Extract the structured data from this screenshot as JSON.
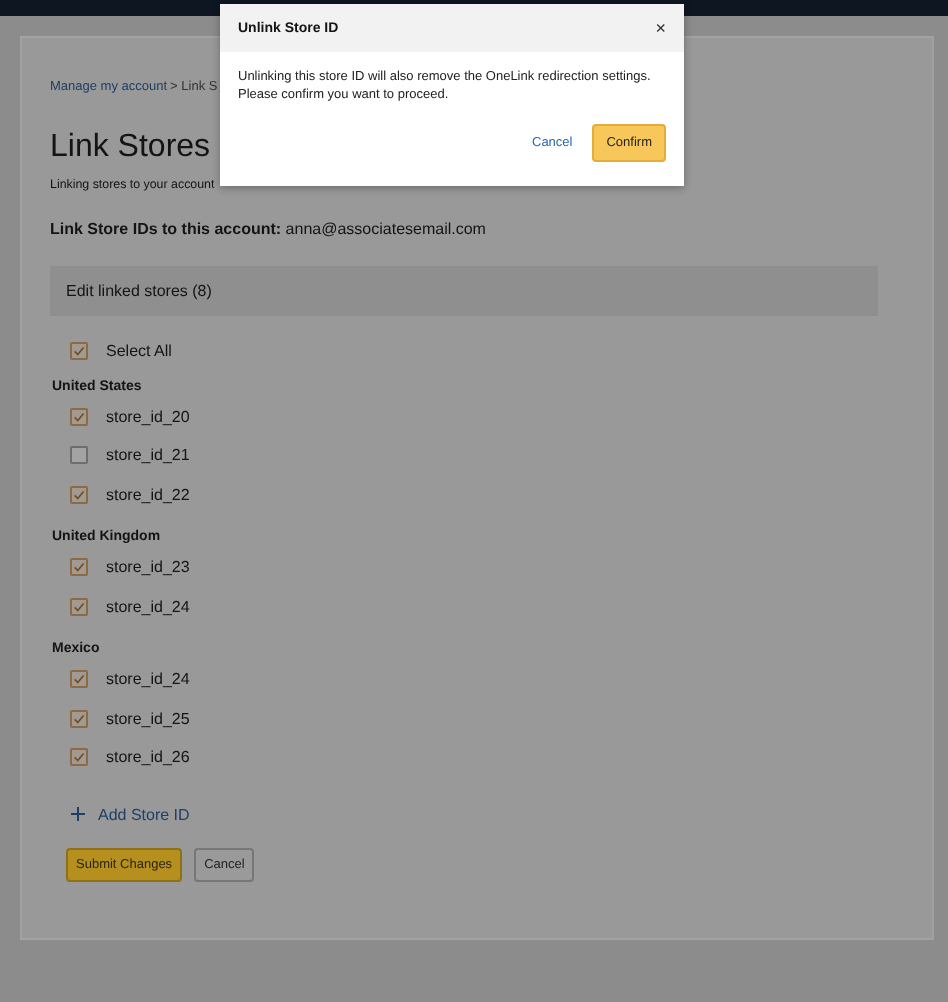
{
  "dialog": {
    "title": "Unlink Store ID",
    "close": "×",
    "message": "Unlinking this store ID will also remove the OneLink redirection settings. Please confirm you want to proceed.",
    "cancel": "Cancel",
    "confirm": "Confirm"
  },
  "breadcrumb": {
    "link": "Manage my account",
    "rest": "> Link S"
  },
  "heading": "Link Stores",
  "subtitle": "Linking stores to your account",
  "account_line": "**Link Store IDs to this account:** anna@associatesemail.com",
  "section": {
    "title": "Edit linked stores (8)"
  },
  "select_all": {
    "label": "Select All",
    "checked": true
  },
  "groups": [
    {
      "name": "United States",
      "stores": [
        {
          "id": "store_id_20",
          "checked": true
        },
        {
          "id": "store_id_21",
          "checked": false
        },
        {
          "id": "store_id_22",
          "checked": true
        }
      ]
    },
    {
      "name": "United Kingdom",
      "stores": [
        {
          "id": "store_id_23",
          "checked": true
        },
        {
          "id": "store_id_24",
          "checked": true
        }
      ]
    },
    {
      "name": "Mexico",
      "stores": [
        {
          "id": "store_id_24",
          "checked": true
        },
        {
          "id": "store_id_25",
          "checked": true
        },
        {
          "id": "store_id_26",
          "checked": true
        }
      ]
    }
  ],
  "add_link": "Add Store ID",
  "buttons": {
    "submit": "Submit Changes",
    "cancel": "Cancel"
  }
}
